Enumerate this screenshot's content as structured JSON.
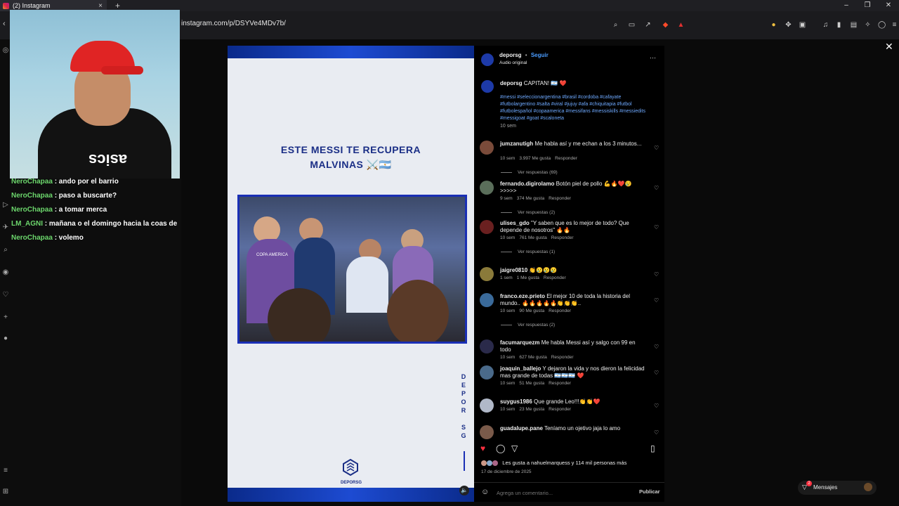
{
  "browser": {
    "tab_title": "(2) Instagram",
    "tab_close": "×",
    "new_tab": "+",
    "url": "instagram.com/p/DSYVe4MDv7b/",
    "window_controls": [
      "–",
      "❐",
      "✕"
    ]
  },
  "chat": [
    {
      "user": "NeroChapaa",
      "message": ": ando por el barrio"
    },
    {
      "user": "NeroChapaa",
      "message": ": paso a buscarte?"
    },
    {
      "user": "NeroChapaa",
      "message": ": a tomar merca"
    },
    {
      "user": "LM_AGNI",
      "message": ": mañana o el domingo hacia la coas de"
    },
    {
      "user": "NeroChapaa",
      "message": ": volemo"
    }
  ],
  "webcam": {
    "shirt_logo": "asics"
  },
  "post": {
    "title_line1": "ESTE MESSI TE RECUPERA",
    "title_line2": "MALVINAS ⚔️🇦🇷",
    "video_label": "COPA AMERICA",
    "vertical_brand": [
      "D",
      "E",
      "P",
      "O",
      "R",
      "",
      "S",
      "G"
    ],
    "logo_text": "DEPORSG",
    "mute_icon": "🔈"
  },
  "panel": {
    "header": {
      "username": "deporsg",
      "separator": "•",
      "follow": "Seguir",
      "audio": "Audio original",
      "more": "···"
    },
    "caption": {
      "username": "deporsg",
      "text": "CAPITAN! 🇦🇷 ❤️",
      "hashtags": "#messi #seleccionargentina #brasil #cordoba #cafayate #futbolargentino #salta #viral #jujuy #afa #chiquitapia #futbol #futbolespañol #copaamerica #messifans #messiskills #messiedits #messigoat #goat #scaloneta",
      "time": "10 sem"
    },
    "comments": [
      {
        "user": "jumzanutigh",
        "text": "Me habla así y me echan a los 3 minutos...",
        "time": "10 sem",
        "likes": "3.997 Me gusta",
        "reply": "Responder",
        "replies": "Ver respuestas (69)",
        "color": "#7a4b3a"
      },
      {
        "user": "fernando.digirolamo",
        "text": "Botón piel de pollo 💪🔥❤️😢 >>>>>",
        "time": "9 sem",
        "likes": "374 Me gusta",
        "reply": "Responder",
        "replies": "Ver respuestas (2)",
        "color": "#5a6e5a"
      },
      {
        "user": "ulises_gdo",
        "text": "\"Y saben que es lo mejor de todo? Que depende de nosotros\" 🔥🔥",
        "time": "10 sem",
        "likes": "761 Me gusta",
        "reply": "Responder",
        "replies": "Ver respuestas (1)",
        "color": "#6a2020"
      },
      {
        "user": "jaigre0810",
        "text": "👏😢😢😢",
        "time": "1 sem",
        "likes": "1 Me gusta",
        "reply": "Responder",
        "replies": "",
        "color": "#8a7a3a"
      },
      {
        "user": "franco.eze.prieto",
        "text": "El mejor 10 de toda la historia del mundo.. 🔥🔥🔥🔥🔥👏👏👏..",
        "time": "10 sem",
        "likes": "90 Me gusta",
        "reply": "Responder",
        "replies": "Ver respuestas (2)",
        "color": "#3a6a9a"
      },
      {
        "user": "facumarquezm",
        "text": "Me habla Messi así y salgo con 99 en todo",
        "time": "10 sem",
        "likes": "627 Me gusta",
        "reply": "Responder",
        "replies": "",
        "color": "#2a2a4a"
      },
      {
        "user": "joaquin_ballejo",
        "text": "Y dejaron la vida y nos dieron la felicidad mas grande de todas 🇦🇷🇦🇷🇦🇷 ❤️",
        "time": "10 sem",
        "likes": "51 Me gusta",
        "reply": "Responder",
        "replies": "",
        "color": "#4a6a8a"
      },
      {
        "user": "suygus1986",
        "text": "Que grande Leo!!!👏👏❤️",
        "time": "10 sem",
        "likes": "23 Me gusta",
        "reply": "Responder",
        "replies": "",
        "color": "#b0b8c8"
      },
      {
        "user": "guadalupe.pane",
        "text": "Teníamo un ojetivo jaja lo amo",
        "time": "",
        "likes": "",
        "reply": "",
        "replies": "",
        "color": "#7a5a4a"
      }
    ],
    "likes_text": "Les gusta a nahuelmarquess y 114 mil personas más",
    "date": "17 de diciembre de 2025",
    "comment_placeholder": "Agrega un comentario...",
    "publish": "Publicar"
  },
  "messages_button": {
    "label": "Mensajes",
    "badge": "2"
  },
  "close": "✕"
}
